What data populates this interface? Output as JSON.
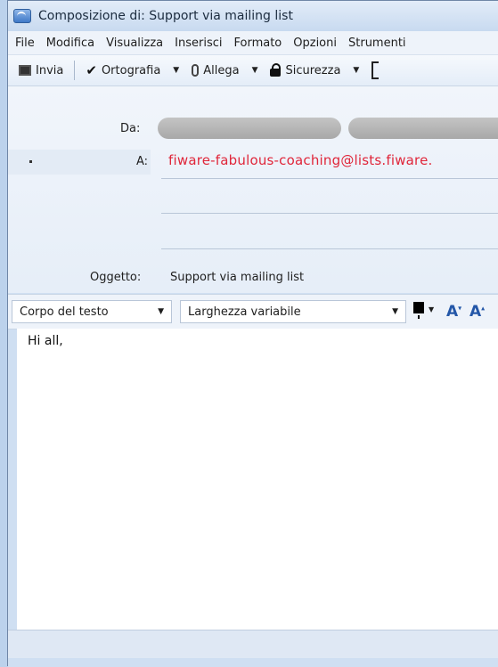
{
  "window": {
    "title": "Composizione di: Support via mailing list"
  },
  "menu": [
    "File",
    "Modifica",
    "Visualizza",
    "Inserisci",
    "Formato",
    "Opzioni",
    "Strumenti"
  ],
  "toolbar": {
    "send": "Invia",
    "spelling": "Ortografia",
    "attach": "Allega",
    "security": "Sicurezza"
  },
  "headers": {
    "from_label": "Da:",
    "to_label": "A:",
    "to_value": "fiware-fabulous-coaching@lists.fiware.",
    "subject_label": "Oggetto:",
    "subject_value": "Support via mailing list"
  },
  "format": {
    "paragraph_style": "Corpo del testo",
    "font": "Larghezza variabile",
    "text_color": "#000000"
  },
  "message": {
    "body": "Hi all,"
  },
  "colors": {
    "recipient": "#e0263a",
    "accent": "#2457a8",
    "chrome": "#cfdff2"
  }
}
